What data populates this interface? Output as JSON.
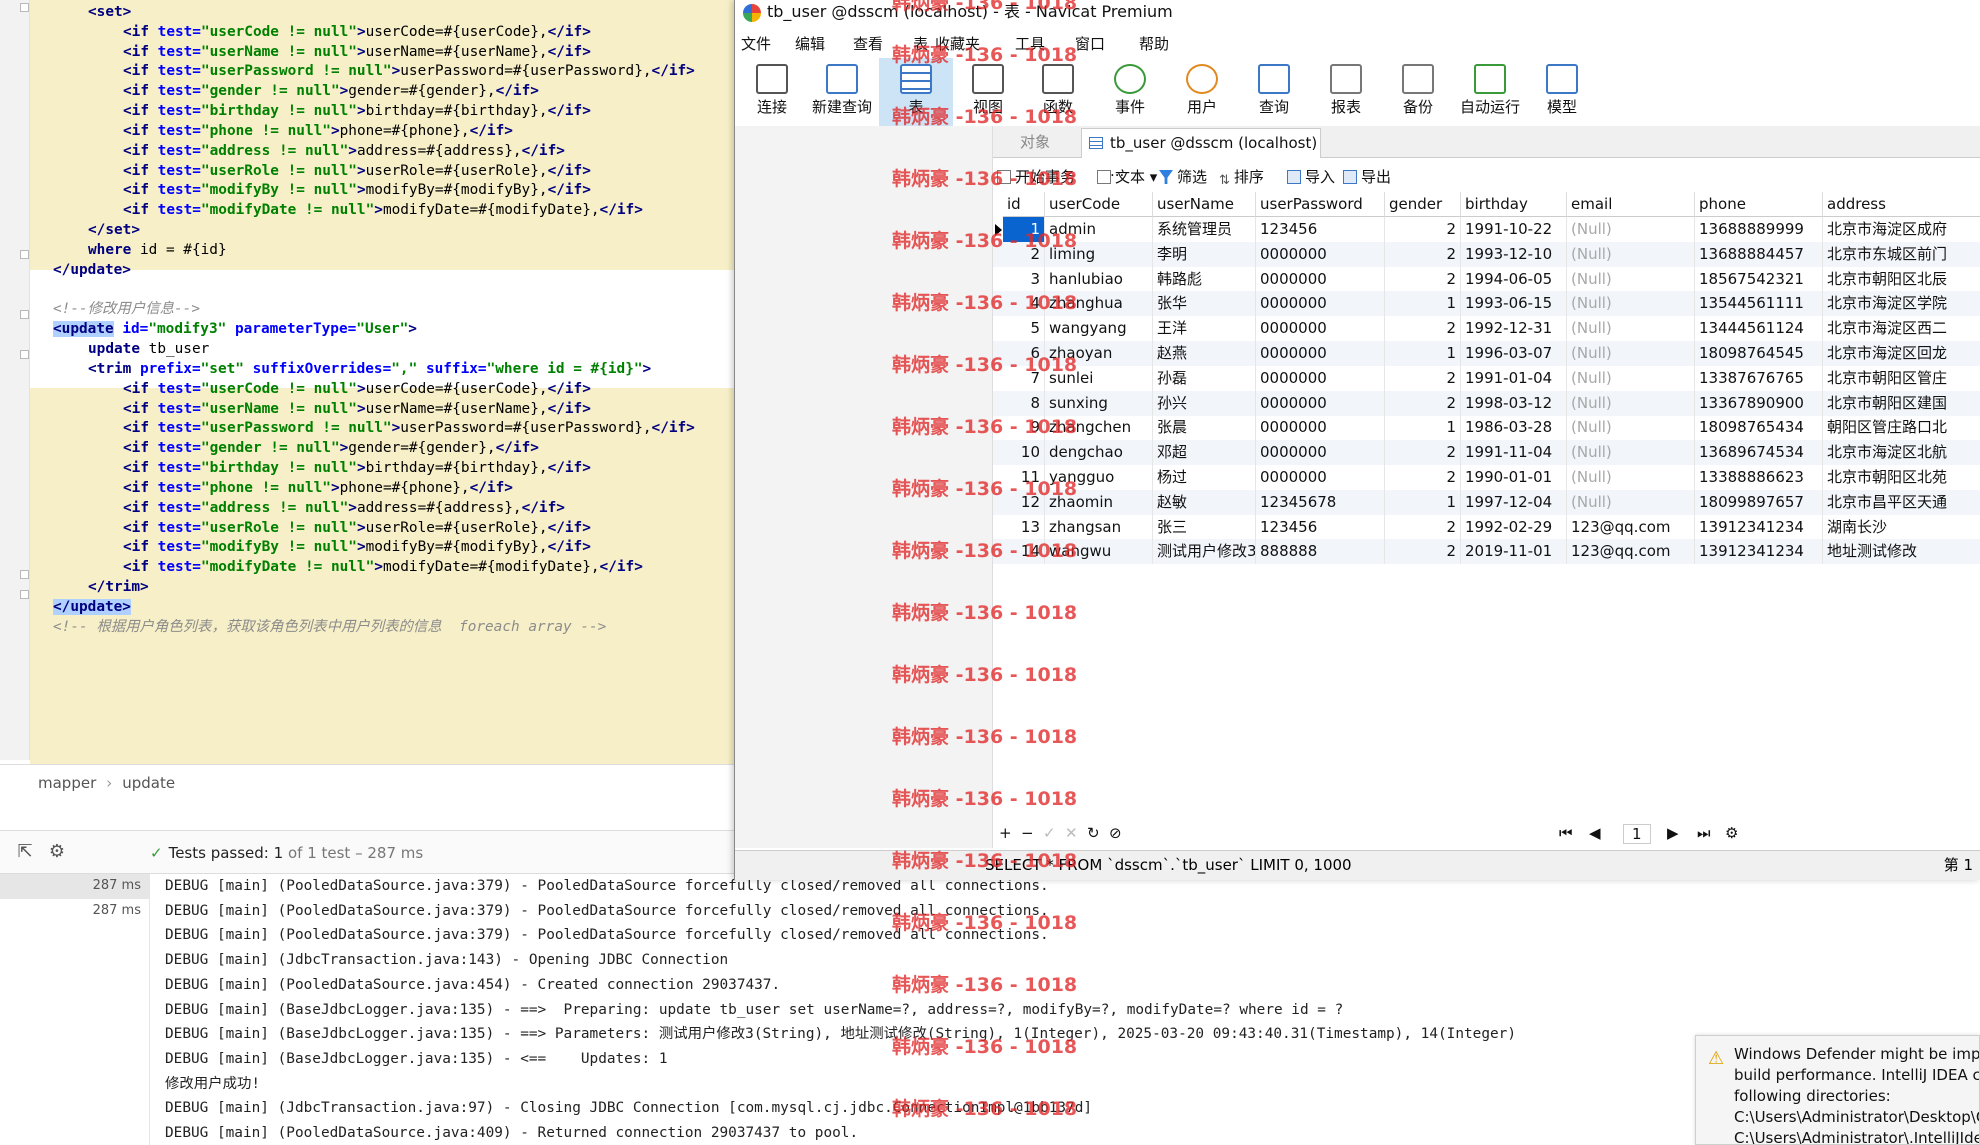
{
  "code_lines": [
    {
      "indent": 2,
      "parts": [
        [
          "tg",
          "<set>"
        ]
      ]
    },
    {
      "indent": 3,
      "parts": [
        [
          "tg",
          "<if "
        ],
        [
          "at",
          "test="
        ],
        [
          "sv",
          "\"userCode != null\""
        ],
        [
          "tg",
          ">"
        ],
        [
          "tx",
          "userCode=#{userCode},"
        ],
        [
          "tg",
          "</if>"
        ]
      ]
    },
    {
      "indent": 3,
      "parts": [
        [
          "tg",
          "<if "
        ],
        [
          "at",
          "test="
        ],
        [
          "sv",
          "\"userName != null\""
        ],
        [
          "tg",
          ">"
        ],
        [
          "tx",
          "userName=#{userName},"
        ],
        [
          "tg",
          "</if>"
        ]
      ]
    },
    {
      "indent": 3,
      "parts": [
        [
          "tg",
          "<if "
        ],
        [
          "at",
          "test="
        ],
        [
          "sv",
          "\"userPassword != null\""
        ],
        [
          "tg",
          ">"
        ],
        [
          "tx",
          "userPassword=#{userPassword},"
        ],
        [
          "tg",
          "</if>"
        ]
      ]
    },
    {
      "indent": 3,
      "parts": [
        [
          "tg",
          "<if "
        ],
        [
          "at",
          "test="
        ],
        [
          "sv",
          "\"gender != null\""
        ],
        [
          "tg",
          ">"
        ],
        [
          "tx",
          "gender=#{gender},"
        ],
        [
          "tg",
          "</if>"
        ]
      ]
    },
    {
      "indent": 3,
      "parts": [
        [
          "tg",
          "<if "
        ],
        [
          "at",
          "test="
        ],
        [
          "sv",
          "\"birthday != null\""
        ],
        [
          "tg",
          ">"
        ],
        [
          "tx",
          "birthday=#{birthday},"
        ],
        [
          "tg",
          "</if>"
        ]
      ]
    },
    {
      "indent": 3,
      "parts": [
        [
          "tg",
          "<if "
        ],
        [
          "at",
          "test="
        ],
        [
          "sv",
          "\"phone != null\""
        ],
        [
          "tg",
          ">"
        ],
        [
          "tx",
          "phone=#{phone},"
        ],
        [
          "tg",
          "</if>"
        ]
      ]
    },
    {
      "indent": 3,
      "parts": [
        [
          "tg",
          "<if "
        ],
        [
          "at",
          "test="
        ],
        [
          "sv",
          "\"address != null\""
        ],
        [
          "tg",
          ">"
        ],
        [
          "tx",
          "address=#{address},"
        ],
        [
          "tg",
          "</if>"
        ]
      ]
    },
    {
      "indent": 3,
      "parts": [
        [
          "tg",
          "<if "
        ],
        [
          "at",
          "test="
        ],
        [
          "sv",
          "\"userRole != null\""
        ],
        [
          "tg",
          ">"
        ],
        [
          "tx",
          "userRole=#{userRole},"
        ],
        [
          "tg",
          "</if>"
        ]
      ]
    },
    {
      "indent": 3,
      "parts": [
        [
          "tg",
          "<if "
        ],
        [
          "at",
          "test="
        ],
        [
          "sv",
          "\"modifyBy != null\""
        ],
        [
          "tg",
          ">"
        ],
        [
          "tx",
          "modifyBy=#{modifyBy},"
        ],
        [
          "tg",
          "</if>"
        ]
      ]
    },
    {
      "indent": 3,
      "parts": [
        [
          "tg",
          "<if "
        ],
        [
          "at",
          "test="
        ],
        [
          "sv",
          "\"modifyDate != null\""
        ],
        [
          "tg",
          ">"
        ],
        [
          "tx",
          "modifyDate=#{modifyDate},"
        ],
        [
          "tg",
          "</if>"
        ]
      ]
    },
    {
      "indent": 2,
      "parts": [
        [
          "tg",
          "</set>"
        ]
      ]
    },
    {
      "indent": 2,
      "parts": [
        [
          "tg",
          "where "
        ],
        [
          "tx",
          "id = #{id}"
        ]
      ]
    },
    {
      "indent": 1,
      "parts": [
        [
          "tg",
          "</update>"
        ]
      ]
    },
    {
      "indent": 0,
      "parts": [
        [
          "tx",
          ""
        ]
      ]
    },
    {
      "indent": 1,
      "parts": [
        [
          "cm",
          "<!--修改用户信息-->"
        ]
      ]
    },
    {
      "indent": 1,
      "parts": [
        [
          "hl",
          "<update"
        ],
        [
          "tg",
          " "
        ],
        [
          "at",
          "id="
        ],
        [
          "sv",
          "\"modify3\""
        ],
        [
          "tg",
          " "
        ],
        [
          "at",
          "parameterType="
        ],
        [
          "sv",
          "\"User\""
        ],
        [
          "tg",
          ">"
        ]
      ]
    },
    {
      "indent": 2,
      "parts": [
        [
          "tg",
          "update "
        ],
        [
          "tx",
          "tb_user"
        ]
      ]
    },
    {
      "indent": 2,
      "parts": [
        [
          "tg",
          "<trim "
        ],
        [
          "at",
          "prefix="
        ],
        [
          "sv",
          "\"set\""
        ],
        [
          "tg",
          " "
        ],
        [
          "at",
          "suffixOverrides="
        ],
        [
          "sv",
          "\",\""
        ],
        [
          "tg",
          " "
        ],
        [
          "at",
          "suffix="
        ],
        [
          "sv",
          "\"where id = #{id}\""
        ],
        [
          "tg",
          ">"
        ]
      ]
    },
    {
      "indent": 3,
      "parts": [
        [
          "tg",
          "<if "
        ],
        [
          "at",
          "test="
        ],
        [
          "sv",
          "\"userCode != null\""
        ],
        [
          "tg",
          ">"
        ],
        [
          "tx",
          "userCode=#{userCode},"
        ],
        [
          "tg",
          "</if>"
        ]
      ]
    },
    {
      "indent": 3,
      "parts": [
        [
          "tg",
          "<if "
        ],
        [
          "at",
          "test="
        ],
        [
          "sv",
          "\"userName != null\""
        ],
        [
          "tg",
          ">"
        ],
        [
          "tx",
          "userName=#{userName},"
        ],
        [
          "tg",
          "</if>"
        ]
      ]
    },
    {
      "indent": 3,
      "parts": [
        [
          "tg",
          "<if "
        ],
        [
          "at",
          "test="
        ],
        [
          "sv",
          "\"userPassword != null\""
        ],
        [
          "tg",
          ">"
        ],
        [
          "tx",
          "userPassword=#{userPassword},"
        ],
        [
          "tg",
          "</if>"
        ]
      ]
    },
    {
      "indent": 3,
      "parts": [
        [
          "tg",
          "<if "
        ],
        [
          "at",
          "test="
        ],
        [
          "sv",
          "\"gender != null\""
        ],
        [
          "tg",
          ">"
        ],
        [
          "tx",
          "gender=#{gender},"
        ],
        [
          "tg",
          "</if>"
        ]
      ]
    },
    {
      "indent": 3,
      "parts": [
        [
          "tg",
          "<if "
        ],
        [
          "at",
          "test="
        ],
        [
          "sv",
          "\"birthday != null\""
        ],
        [
          "tg",
          ">"
        ],
        [
          "tx",
          "birthday=#{birthday},"
        ],
        [
          "tg",
          "</if>"
        ]
      ]
    },
    {
      "indent": 3,
      "parts": [
        [
          "tg",
          "<if "
        ],
        [
          "at",
          "test="
        ],
        [
          "sv",
          "\"phone != null\""
        ],
        [
          "tg",
          ">"
        ],
        [
          "tx",
          "phone=#{phone},"
        ],
        [
          "tg",
          "</if>"
        ]
      ]
    },
    {
      "indent": 3,
      "parts": [
        [
          "tg",
          "<if "
        ],
        [
          "at",
          "test="
        ],
        [
          "sv",
          "\"address != null\""
        ],
        [
          "tg",
          ">"
        ],
        [
          "tx",
          "address=#{address},"
        ],
        [
          "tg",
          "</if>"
        ]
      ]
    },
    {
      "indent": 3,
      "parts": [
        [
          "tg",
          "<if "
        ],
        [
          "at",
          "test="
        ],
        [
          "sv",
          "\"userRole != null\""
        ],
        [
          "tg",
          ">"
        ],
        [
          "tx",
          "userRole=#{userRole},"
        ],
        [
          "tg",
          "</if>"
        ]
      ]
    },
    {
      "indent": 3,
      "parts": [
        [
          "tg",
          "<if "
        ],
        [
          "at",
          "test="
        ],
        [
          "sv",
          "\"modifyBy != null\""
        ],
        [
          "tg",
          ">"
        ],
        [
          "tx",
          "modifyBy=#{modifyBy},"
        ],
        [
          "tg",
          "</if>"
        ]
      ]
    },
    {
      "indent": 3,
      "parts": [
        [
          "tg",
          "<if "
        ],
        [
          "at",
          "test="
        ],
        [
          "sv",
          "\"modifyDate != null\""
        ],
        [
          "tg",
          ">"
        ],
        [
          "tx",
          "modifyDate=#{modifyDate},"
        ],
        [
          "tg",
          "</if>"
        ]
      ]
    },
    {
      "indent": 2,
      "parts": [
        [
          "tg",
          "</trim>"
        ]
      ]
    },
    {
      "indent": 1,
      "parts": [
        [
          "hl",
          "</update>"
        ]
      ]
    },
    {
      "indent": 1,
      "parts": [
        [
          "cm",
          "<!-- 根据用户角色列表，获取该角色列表中用户列表的信息  foreach array -->"
        ]
      ]
    }
  ],
  "breadcrumb": [
    "mapper",
    "update"
  ],
  "tests": {
    "label": "Tests passed:",
    "count": "1",
    "of": "of 1 test",
    "time": "– 287 ms"
  },
  "durations": [
    "287 ms",
    "287 ms"
  ],
  "console_lines": [
    "DEBUG [main] (PooledDataSource.java:379) - PooledDataSource forcefully closed/removed all connections.",
    "DEBUG [main] (PooledDataSource.java:379) - PooledDataSource forcefully closed/removed all connections.",
    "DEBUG [main] (PooledDataSource.java:379) - PooledDataSource forcefully closed/removed all connections.",
    "DEBUG [main] (JdbcTransaction.java:143) - Opening JDBC Connection",
    "DEBUG [main] (PooledDataSource.java:454) - Created connection 29037437.",
    "DEBUG [main] (BaseJdbcLogger.java:135) - ==>  Preparing: update tb_user set userName=?, address=?, modifyBy=?, modifyDate=? where id = ?",
    "DEBUG [main] (BaseJdbcLogger.java:135) - ==> Parameters: 测试用户修改3(String), 地址测试修改(String), 1(Integer), 2025-03-20 09:43:40.31(Timestamp), 14(Integer)",
    "DEBUG [main] (BaseJdbcLogger.java:135) - <==    Updates: 1",
    "修改用户成功!",
    "DEBUG [main] (JdbcTransaction.java:97) - Closing JDBC Connection [com.mysql.cj.jdbc.ConnectionImpl@1bb137d]",
    "DEBUG [main] (PooledDataSource.java:409) - Returned connection 29037437 to pool."
  ],
  "notice": {
    "text": "Windows Defender might be impa\nbuild performance. IntelliJ IDEA ch\nfollowing directories:\nC:\\Users\\Administrator\\Desktop\\C\nC:\\Users\\Administrator\\.IntelliJIde"
  },
  "navicat": {
    "title": "tb_user @dsscm (localhost) - 表 - Navicat Premium",
    "menu": [
      "文件",
      "编辑",
      "查看",
      "表",
      "收藏夹",
      "工具",
      "窗口",
      "帮助"
    ],
    "toolbar": [
      {
        "label": "连接",
        "icon": "connect-icon"
      },
      {
        "label": "新建查询",
        "icon": "new-query-icon"
      },
      {
        "label": "表",
        "icon": "table-icon"
      },
      {
        "label": "视图",
        "icon": "view-icon"
      },
      {
        "label": "函数",
        "icon": "function-icon"
      },
      {
        "label": "事件",
        "icon": "event-icon"
      },
      {
        "label": "用户",
        "icon": "user-icon"
      },
      {
        "label": "查询",
        "icon": "query-icon"
      },
      {
        "label": "报表",
        "icon": "report-icon"
      },
      {
        "label": "备份",
        "icon": "backup-icon"
      },
      {
        "label": "自动运行",
        "icon": "automation-icon"
      },
      {
        "label": "模型",
        "icon": "model-icon"
      }
    ],
    "tab_objects": "对象",
    "tab_active": "tb_user @dsscm (localhost) ...",
    "grid_toolbar": [
      "开始事务",
      "文本",
      "筛选",
      "排序",
      "导入",
      "导出"
    ],
    "columns": [
      "id",
      "userCode",
      "userName",
      "userPassword",
      "gender",
      "birthday",
      "email",
      "phone",
      "address"
    ],
    "rows": [
      [
        "1",
        "admin",
        "系统管理员",
        "123456",
        "2",
        "1991-10-22",
        "(Null)",
        "13688889999",
        "北京市海淀区成府"
      ],
      [
        "2",
        "liming",
        "李明",
        "0000000",
        "2",
        "1993-12-10",
        "(Null)",
        "13688884457",
        "北京市东城区前门"
      ],
      [
        "3",
        "hanlubiao",
        "韩路彪",
        "0000000",
        "2",
        "1994-06-05",
        "(Null)",
        "18567542321",
        "北京市朝阳区北辰"
      ],
      [
        "4",
        "zhanghua",
        "张华",
        "0000000",
        "1",
        "1993-06-15",
        "(Null)",
        "13544561111",
        "北京市海淀区学院"
      ],
      [
        "5",
        "wangyang",
        "王洋",
        "0000000",
        "2",
        "1992-12-31",
        "(Null)",
        "13444561124",
        "北京市海淀区西二"
      ],
      [
        "6",
        "zhaoyan",
        "赵燕",
        "0000000",
        "1",
        "1996-03-07",
        "(Null)",
        "18098764545",
        "北京市海淀区回龙"
      ],
      [
        "7",
        "sunlei",
        "孙磊",
        "0000000",
        "2",
        "1991-01-04",
        "(Null)",
        "13387676765",
        "北京市朝阳区管庄"
      ],
      [
        "8",
        "sunxing",
        "孙兴",
        "0000000",
        "2",
        "1998-03-12",
        "(Null)",
        "13367890900",
        "北京市朝阳区建国"
      ],
      [
        "9",
        "zhangchen",
        "张晨",
        "0000000",
        "1",
        "1986-03-28",
        "(Null)",
        "18098765434",
        "朝阳区管庄路口北"
      ],
      [
        "10",
        "dengchao",
        "邓超",
        "0000000",
        "2",
        "1991-11-04",
        "(Null)",
        "13689674534",
        "北京市海淀区北航"
      ],
      [
        "11",
        "yangguo",
        "杨过",
        "0000000",
        "2",
        "1990-01-01",
        "(Null)",
        "13388886623",
        "北京市朝阳区北苑"
      ],
      [
        "12",
        "zhaomin",
        "赵敏",
        "12345678",
        "1",
        "1997-12-04",
        "(Null)",
        "18099897657",
        "北京市昌平区天通"
      ],
      [
        "13",
        "zhangsan",
        "张三",
        "123456",
        "2",
        "1992-02-29",
        "123@qq.com",
        "13912341234",
        "湖南长沙"
      ],
      [
        "14",
        "wangwu",
        "测试用户修改3",
        "888888",
        "2",
        "2019-11-01",
        "123@qq.com",
        "13912341234",
        "地址测试修改"
      ]
    ],
    "pager": {
      "page": "1"
    },
    "status_sql": "SELECT * FROM `dsscm`.`tb_user` LIMIT 0, 1000",
    "status_page": "第 1"
  },
  "watermark": "韩炳豪 -136 - 1018"
}
